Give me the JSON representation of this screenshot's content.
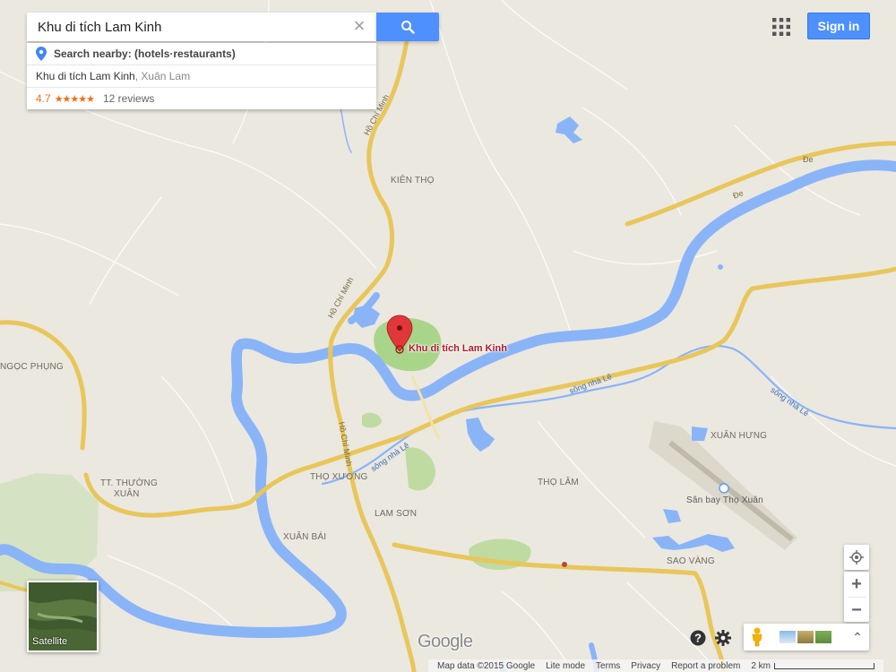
{
  "search": {
    "value": "Khu di tích Lam Kinh",
    "suggest_nearby": "Search nearby: (hotels·restaurants)",
    "result_place": "Khu di tích Lam Kinh",
    "result_sub": ", Xuân Lam",
    "rating": "4.7",
    "stars": "★★★★★",
    "reviews": "12 reviews"
  },
  "header": {
    "signin_label": "Sign in"
  },
  "marker": {
    "label": "Khu di tích Lam Kinh"
  },
  "map_labels": {
    "kien_tho": "KIÊN THỌ",
    "ngoc_phung": "NGỌC PHỤNG",
    "tt_thuong_xuan_1": "TT. THƯỜNG",
    "tt_thuong_xuan_2": "XUÂN",
    "tho_xuong": "THỌ XƯƠNG",
    "lam_son": "LAM SƠN",
    "xuan_bai": "XUÂN BÁI",
    "tho_lam": "THỌ LÂM",
    "xuan_hung": "XUÂN HƯNG",
    "san_bay": "Sân bay Thọ Xuân",
    "sao_vang": "SAO VÀNG",
    "ho_chi_minh": "Hồ Chí Minh",
    "de": "Đe",
    "song_nha_le": "sông nhà Lê"
  },
  "controls": {
    "satellite_label": "Satellite",
    "zoom_in": "+",
    "zoom_out": "−",
    "expand": "⌃"
  },
  "logo": "Google",
  "footer": {
    "map_data": "Map data ©2015 Google",
    "lite_mode": "Lite mode",
    "terms": "Terms",
    "privacy": "Privacy",
    "report": "Report a problem",
    "scale": "2 km"
  },
  "colors": {
    "land": "#ebe8e0",
    "river": "#8ab4f8",
    "road": "#f6d36b",
    "park": "#cde3b0",
    "accent": "#4d90fe",
    "marker": "#e0383a"
  },
  "icons": {
    "search": "search-icon",
    "clear": "close-icon",
    "apps": "apps-grid-icon",
    "location": "my-location-icon",
    "help": "help-icon",
    "settings": "gear-icon",
    "pegman": "pegman-icon",
    "pin": "map-pin-icon"
  }
}
